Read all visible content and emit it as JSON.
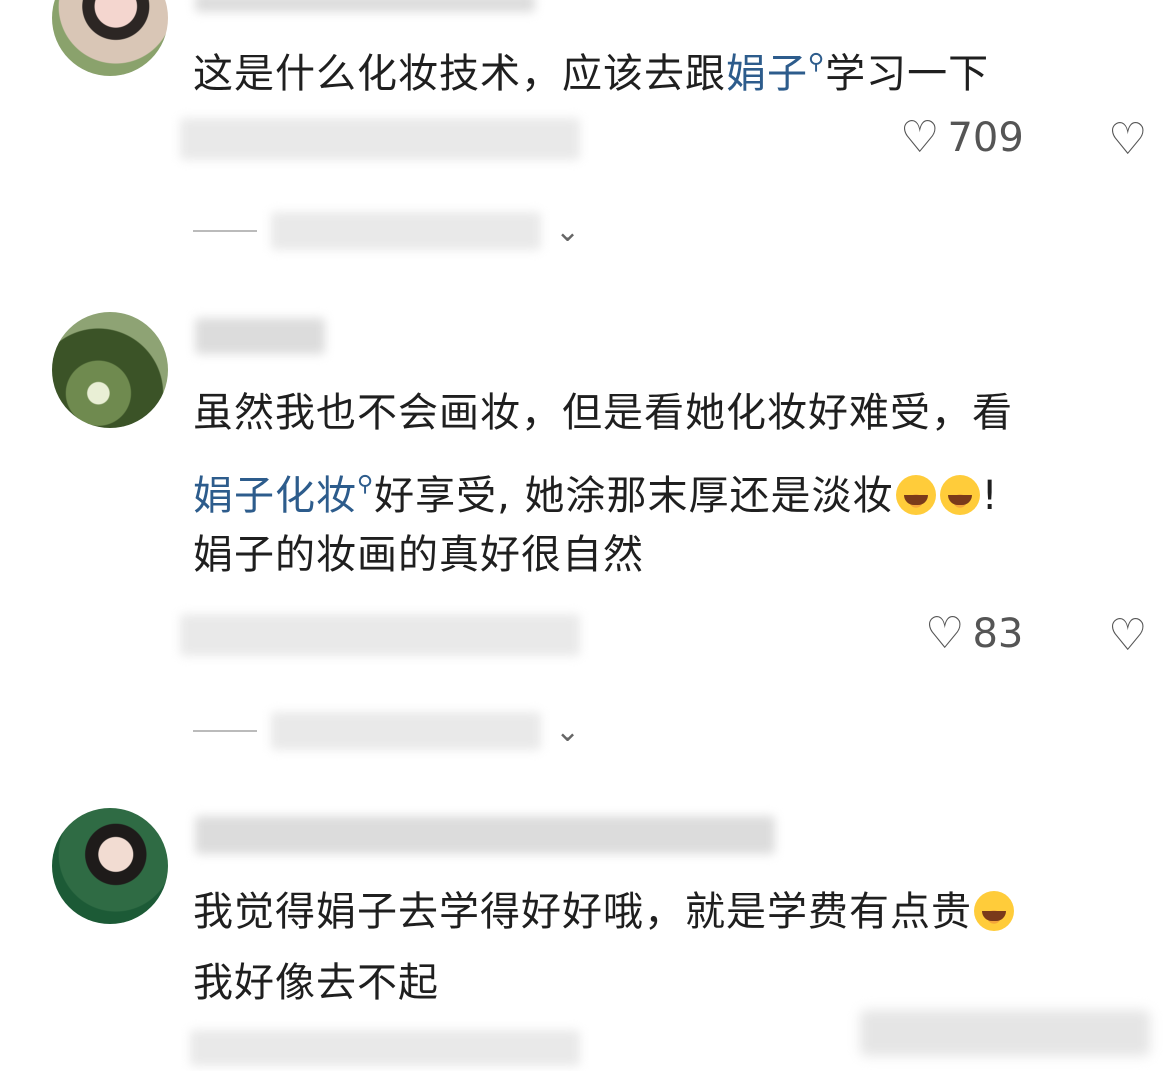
{
  "comments": [
    {
      "text_parts": [
        "这是什么化妆技术，应该去跟",
        "娟子",
        "学习一下"
      ],
      "likes": "709"
    },
    {
      "line1": "虽然我也不会画妆，但是看她化妆好难受，看",
      "line2_link": "娟子化妆",
      "line2_rest": "好享受, 她涂那末厚还是淡妆",
      "line2_end": "!",
      "line3": "娟子的妆画的真好很自然",
      "likes": "83"
    },
    {
      "line1": "我觉得娟子去学得好好哦，就是学费有点贵",
      "line2": "我好像去不起"
    }
  ],
  "icons": {
    "like": "heart-outline-icon",
    "dislike": "broken-heart-icon",
    "expand": "chevron-down-icon",
    "search_hint": "search-icon"
  },
  "colors": {
    "link": "#2d5c8c",
    "text": "#1f1f1f"
  }
}
